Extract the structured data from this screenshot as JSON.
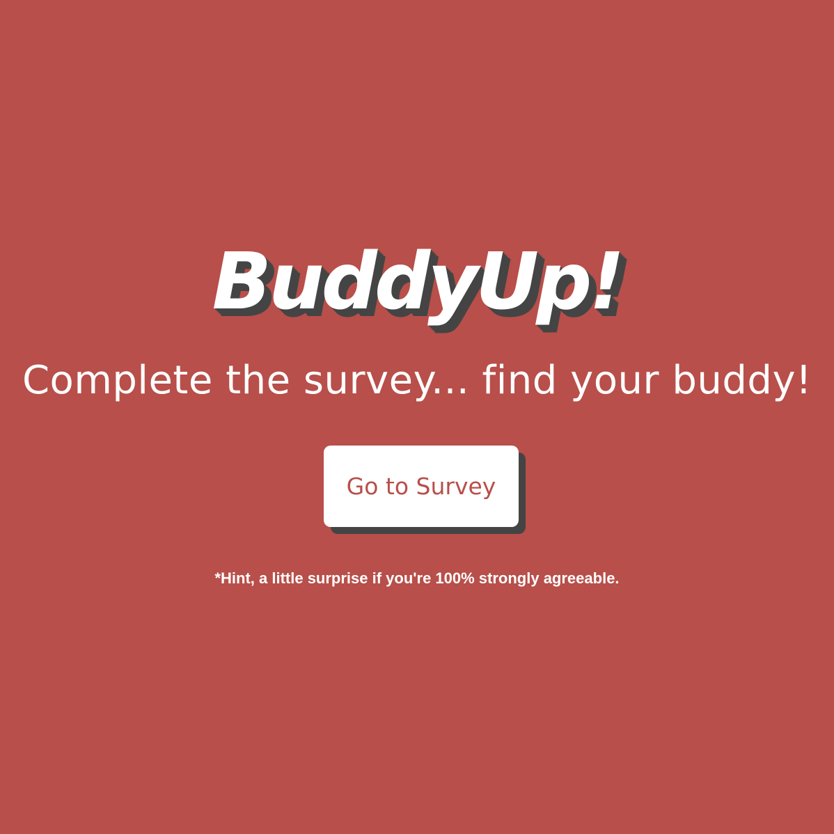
{
  "hero": {
    "title": "BuddyUp!",
    "tagline": "Complete the survey... find your buddy!",
    "button_label": "Go to Survey",
    "hint": "*Hint, a little surprise if you're 100% strongly agreeable."
  },
  "colors": {
    "background": "#b84f4a",
    "text": "#ffffff",
    "shadow": "#444444",
    "button_text": "#b84f4a"
  }
}
